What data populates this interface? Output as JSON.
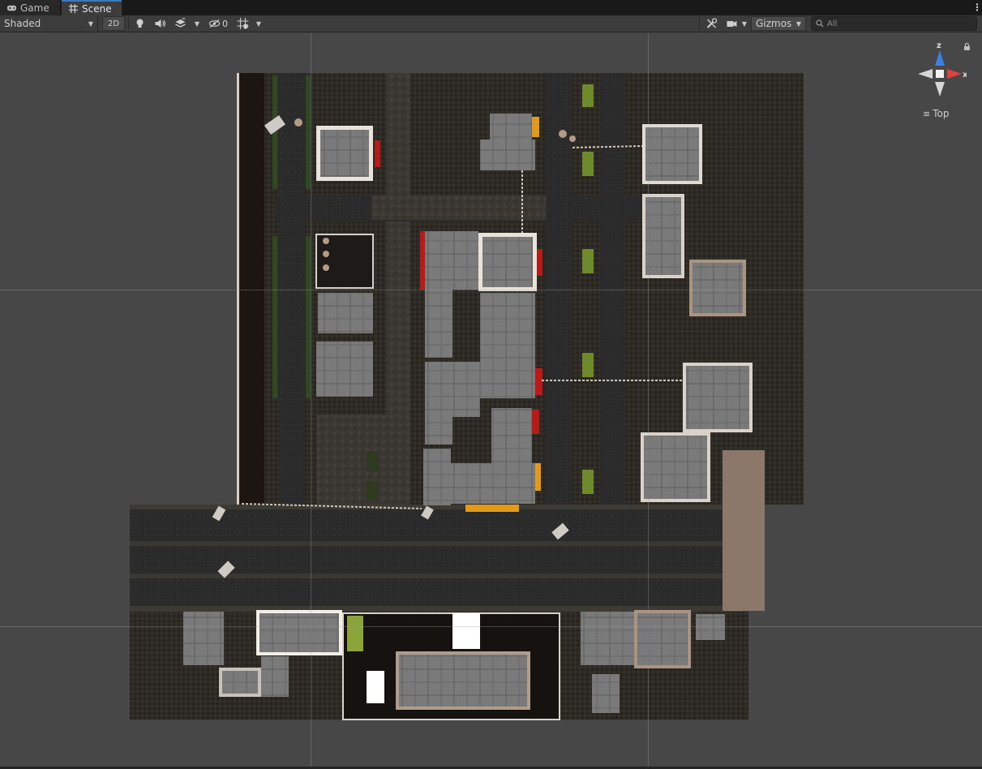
{
  "tabs": [
    {
      "label": "Game",
      "icon": "gamepad-icon"
    },
    {
      "label": "Scene",
      "icon": "grid-icon",
      "active": true
    }
  ],
  "toolbar": {
    "draw_mode": "Shaded",
    "mode_2d": "2D",
    "hidden_count": "0",
    "gizmos_label": "Gizmos",
    "search_placeholder": "All"
  },
  "orientation": {
    "axis_z": "z",
    "axis_x": "x",
    "view": "Top"
  },
  "colors": {
    "tab_accent": "#3a79bb",
    "axis_x": "#e0413a",
    "axis_z": "#3e7fe0",
    "axis_y": "#cfcfcf"
  }
}
